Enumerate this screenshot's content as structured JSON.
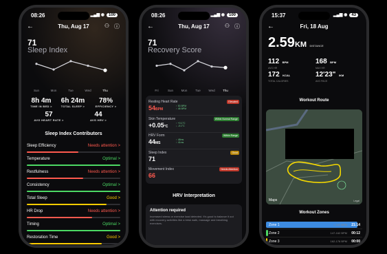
{
  "phone1": {
    "status_time": "08:26",
    "battery": "100",
    "date": "Thu, Aug 17",
    "score": "71",
    "title": "Sleep Index",
    "days": [
      "Sun",
      "Mon",
      "Tue",
      "Wed",
      "Thu"
    ],
    "stats": [
      {
        "value": "8h 4m",
        "label": "TIME IN BED >"
      },
      {
        "value": "6h 24m",
        "label": "TOTAL SLEEP >"
      },
      {
        "value": "78%",
        "label": "EFFICIENCY >"
      },
      {
        "value": "57",
        "label": "AVG HEART RATE >"
      },
      {
        "value": "44",
        "label": "AVG HRV >"
      }
    ],
    "section_title": "Sleep Index Contributors",
    "contributors": [
      {
        "name": "Sleep Efficiency",
        "status": "Needs attention >",
        "color": "#ff5a4f",
        "level": 0.55
      },
      {
        "name": "Temperature",
        "status": "Optimal >",
        "color": "#4cd964",
        "level": 1.0
      },
      {
        "name": "Restfulness",
        "status": "Needs attention >",
        "color": "#ff5a4f",
        "level": 0.6
      },
      {
        "name": "Consistency",
        "status": "Optimal >",
        "color": "#4cd964",
        "level": 1.0
      },
      {
        "name": "Total Sleep",
        "status": "Good >",
        "color": "#ffcc00",
        "level": 0.85
      },
      {
        "name": "HR Drop",
        "status": "Needs attention >",
        "color": "#ff5a4f",
        "level": 0.7
      },
      {
        "name": "Timing",
        "status": "Optimal >",
        "color": "#4cd964",
        "level": 1.0
      },
      {
        "name": "Restoration Time",
        "status": "Good >",
        "color": "#ffcc00",
        "level": 0.8
      }
    ]
  },
  "phone2": {
    "status_time": "08:26",
    "battery": "100",
    "date": "Thu, Aug 17",
    "score": "71",
    "title": "Recovery Score",
    "days": [
      "Fri",
      "Sun",
      "Mon",
      "Tue",
      "Wed",
      "Thu"
    ],
    "metrics": [
      {
        "title": "Resting Heart Rate",
        "value": "54",
        "unit": "BPM",
        "badge": "Elevated",
        "badge_color": "#c0392b",
        "value_color": "#ff5a4f",
        "deltas": [
          "↑ 53 BPM",
          "↑ 48 BPM"
        ]
      },
      {
        "title": "Skin Temperature",
        "value": "+0.05",
        "unit": "°C",
        "badge": "Within Normal Range",
        "badge_color": "#2e7d32",
        "value_color": "#ffffff",
        "deltas": [
          "↑ +0.1°C",
          "↓ -0.1°C"
        ]
      },
      {
        "title": "HRV Form",
        "value": "44",
        "unit": "MS",
        "badge": "Within Range",
        "badge_color": "#2e7d32",
        "value_color": "#ffffff",
        "deltas": [
          "↑ 48ms",
          "↑ 41ms"
        ]
      },
      {
        "title": "Sleep Index",
        "value": "71",
        "unit": "",
        "badge": "Good",
        "badge_color": "#b8860b",
        "value_color": "#ffffff",
        "deltas": []
      },
      {
        "title": "Movement Index",
        "value": "66",
        "unit": "",
        "badge": "Needs Attention",
        "badge_color": "#c0392b",
        "value_color": "#ff5a4f",
        "deltas": []
      }
    ],
    "section_title": "HRV Interpretation",
    "attention_title": "Attention required",
    "attention_text": "Increased stress or exercise load detected. It's good to balance it out with recovery activities like a brisk walk, massage and breathing exercises."
  },
  "phone3": {
    "status_time": "15:37",
    "battery": "43",
    "date": "Fri, 18 Aug",
    "distance": "2.59",
    "distance_unit": "KM",
    "distance_label": "DISTANCE",
    "stats": [
      {
        "value": "112",
        "unit": "BPM",
        "label": "AVG HR"
      },
      {
        "value": "168",
        "unit": "BPM",
        "label": "MAX HR"
      },
      {
        "value": "172",
        "unit": "KCAL",
        "label": "TOTAL CALORIES"
      },
      {
        "value": "12'23\"",
        "unit": "/KM",
        "label": "AVG PACE"
      }
    ],
    "route_title": "Workout Route",
    "map_label": "Maps",
    "map_legal": "Legal",
    "zones_title": "Workout Zones",
    "zones": [
      {
        "name": "Zone 1",
        "range": "< 147 BPM",
        "time": "21:14",
        "color": "#3d8be0",
        "fraction": 0.95
      },
      {
        "name": "Zone 2",
        "range": "147-162 BPM",
        "time": "00:12",
        "color": "#4cd964",
        "fraction": 0.02
      },
      {
        "name": "Zone 3",
        "range": "162-176 BPM",
        "time": "00:00",
        "color": "#ffcc00",
        "fraction": 0.0
      }
    ],
    "sleep_chart_values": [
      55,
      40,
      62,
      50,
      38
    ],
    "recovery_chart_values": [
      50,
      55,
      38,
      62,
      48,
      45
    ]
  }
}
